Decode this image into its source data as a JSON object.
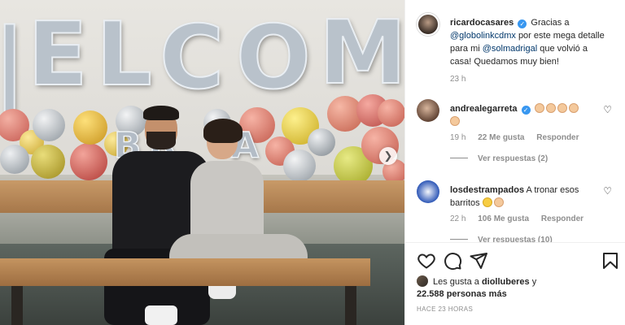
{
  "post": {
    "author": "ricardocasares",
    "caption_parts": {
      "pre": "Gracias a",
      "mention1": "@globolinkcdmx",
      "mid": "por este mega detalle para mi",
      "mention2": "@solmadrigal",
      "post": "que volvió a casa! Quedamos muy bien!"
    },
    "caption_time": "23 h",
    "likes": {
      "prefix": "Les gusta a",
      "user": "diolluberes",
      "joiner": "y",
      "count": "22.588 personas más"
    },
    "posted_ago": "HACE 23 HORAS"
  },
  "photo": {
    "balloon_word": [
      "E",
      "L",
      "C",
      "O",
      "M"
    ],
    "small_letters": [
      "B",
      "R",
      "A"
    ]
  },
  "comments": [
    {
      "user": "andrealegarreta",
      "verified": true,
      "text": "",
      "emoji_count": 5,
      "time": "19 h",
      "likes": "22 Me gusta",
      "reply": "Responder",
      "replies": "Ver respuestas (2)"
    },
    {
      "user": "losdestrampados",
      "verified": false,
      "text": "A tronar esos barritos",
      "emoji_count": 2,
      "time": "22 h",
      "likes": "106 Me gusta",
      "reply": "Responder",
      "replies": "Ver respuestas (10)"
    }
  ],
  "icons": {
    "like": "heart-icon",
    "comment": "comment-icon",
    "share": "send-icon",
    "save": "bookmark-icon",
    "next": "chevron-right-icon"
  },
  "colors": {
    "mention": "#00376b",
    "verified": "#3897f0",
    "muted": "#8e8e8e",
    "text": "#262626"
  }
}
